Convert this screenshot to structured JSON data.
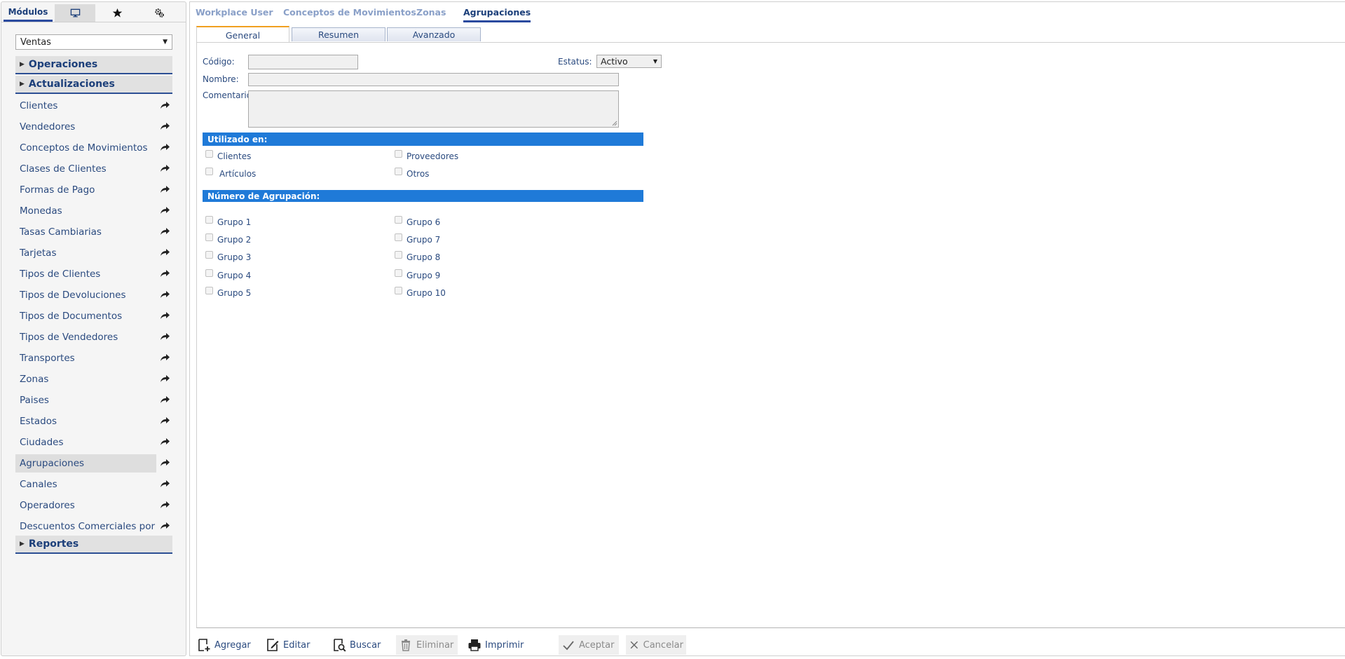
{
  "sidebar": {
    "tabs": {
      "modulos": "Módulos",
      "desktop_icon": "monitor-icon",
      "fav_icon": "star-icon",
      "config_icon": "gear-icon"
    },
    "module_select": "Ventas",
    "sections": {
      "operaciones": "Operaciones",
      "actualizaciones": "Actualizaciones",
      "reportes": "Reportes"
    },
    "items": [
      "Clientes",
      "Vendedores",
      "Conceptos de Movimientos",
      "Clases de Clientes",
      "Formas de Pago",
      "Monedas",
      "Tasas Cambiarias",
      "Tarjetas",
      "Tipos de Clientes",
      "Tipos de Devoluciones",
      "Tipos de Documentos",
      "Tipos de Vendedores",
      "Transportes",
      "Zonas",
      "Paises",
      "Estados",
      "Ciudades",
      "Agrupaciones",
      "Canales",
      "Operadores",
      "Descuentos Comerciales por V"
    ],
    "selected_item": "Agrupaciones"
  },
  "top_tabs": [
    "Workplace User",
    "Conceptos de Movimientos",
    "Zonas",
    "Agrupaciones"
  ],
  "active_top_tab": "Agrupaciones",
  "sub_tabs": [
    "General",
    "Resumen",
    "Avanzado"
  ],
  "active_sub_tab": "General",
  "form": {
    "codigo_label": "Código:",
    "codigo_value": "",
    "estatus_label": "Estatus:",
    "estatus_value": "Activo",
    "nombre_label": "Nombre:",
    "nombre_value": "",
    "comentario_label": "Comentario:",
    "comentario_value": "",
    "utilizado_header": "Utilizado en:",
    "utilizado": [
      "Clientes",
      "Proveedores",
      "Artículos",
      "Otros"
    ],
    "agrupacion_header": "Número de Agrupación:",
    "grupos": [
      "Grupo 1",
      "Grupo 2",
      "Grupo 3",
      "Grupo 4",
      "Grupo 5",
      "Grupo 6",
      "Grupo 7",
      "Grupo 8",
      "Grupo 9",
      "Grupo 10"
    ]
  },
  "toolbar": {
    "agregar": "Agregar",
    "editar": "Editar",
    "buscar": "Buscar",
    "eliminar": "Eliminar",
    "imprimir": "Imprimir",
    "aceptar": "Aceptar",
    "cancelar": "Cancelar"
  }
}
